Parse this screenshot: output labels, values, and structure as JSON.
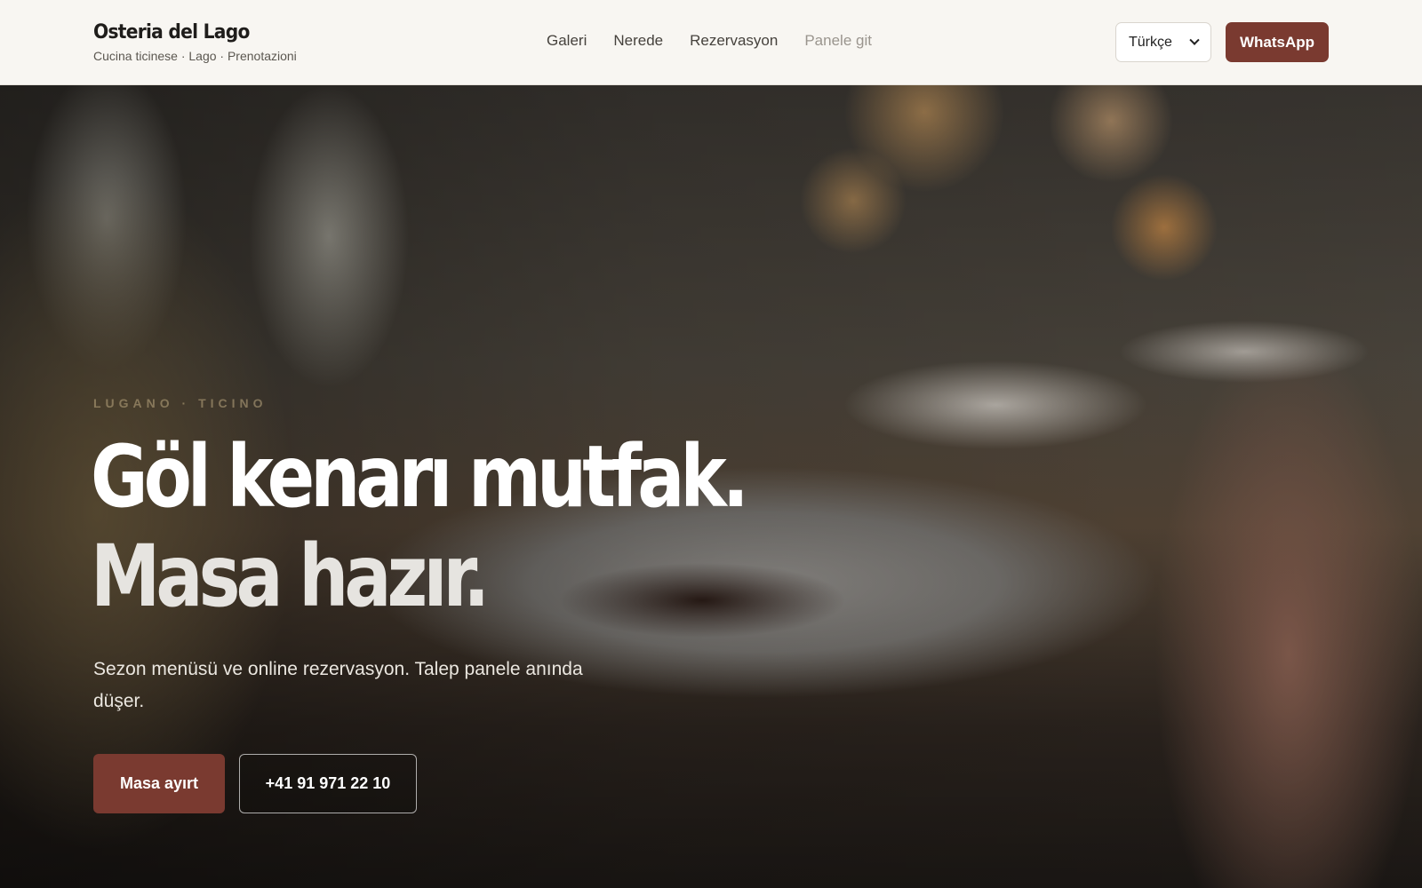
{
  "brand": {
    "name": "Osteria del Lago",
    "tagline": "Cucina ticinese · Lago · Prenotazioni"
  },
  "nav": {
    "items": [
      {
        "label": "Galeri"
      },
      {
        "label": "Nerede"
      },
      {
        "label": "Rezervasyon"
      },
      {
        "label": "Panele git"
      }
    ]
  },
  "language_select": {
    "value": "Türkçe"
  },
  "whatsapp_button": {
    "label": "WhatsApp"
  },
  "hero": {
    "eyebrow": "LUGANO · TICINO",
    "headline_line1": "Göl kenarı mutfak.",
    "headline_line2": "Masa hazır.",
    "subtitle": "Sezon menüsü ve online rezervasyon. Talep panele anında düşer.",
    "primary_cta": "Masa ayırt",
    "phone_cta": "+41 91 971 22 10"
  },
  "colors": {
    "accent": "#7a3a30",
    "header_bg": "#f8f6f2"
  }
}
